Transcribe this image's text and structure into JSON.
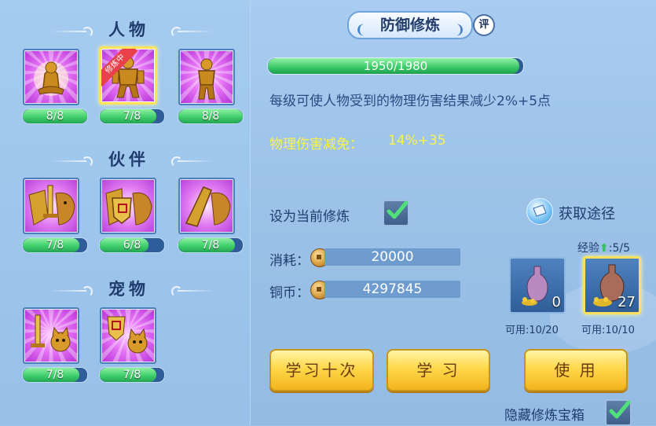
{
  "left_panel": {
    "sections": [
      {
        "title": "人物",
        "items": [
          {
            "icon": "character-seated-icon",
            "progress_text": "8/8",
            "progress": 1.0,
            "training": false
          },
          {
            "icon": "character-armor-icon",
            "progress_text": "7/8",
            "progress": 0.875,
            "training": true,
            "ribbon": "修炼中"
          },
          {
            "icon": "character-standing-icon",
            "progress_text": "8/8",
            "progress": 1.0,
            "training": false
          }
        ]
      },
      {
        "title": "伙伴",
        "items": [
          {
            "icon": "partner-sword-icon",
            "progress_text": "7/8",
            "progress": 0.875
          },
          {
            "icon": "partner-shield-icon",
            "progress_text": "6/8",
            "progress": 0.75
          },
          {
            "icon": "partner-gauntlet-icon",
            "progress_text": "7/8",
            "progress": 0.875
          }
        ]
      },
      {
        "title": "宠物",
        "items": [
          {
            "icon": "pet-sword-icon",
            "progress_text": "7/8",
            "progress": 0.875
          },
          {
            "icon": "pet-shield-icon",
            "progress_text": "7/8",
            "progress": 0.875
          }
        ]
      }
    ]
  },
  "detail": {
    "title": "防御修炼",
    "rate_badge": "评",
    "exp_text": "1950/1980",
    "exp_progress": 0.985,
    "description": "每级可使人物受到的物理伤害结果减少2%+5点",
    "effect_label": "物理伤害减免：",
    "effect_value": "14%+35",
    "set_current_label": "设为当前修炼",
    "set_current_checked": true,
    "get_way_label": "获取途径",
    "cost_label": "消耗：",
    "cost_value": "20000",
    "coin_label": "铜币：",
    "coin_value": "4297845",
    "learn_ten_label": "学习十次",
    "learn_label": "学 习",
    "use_label": "使 用",
    "exp_info_label": "经验",
    "exp_info_value": ":5/5",
    "items": [
      {
        "icon": "potion-vase-icon",
        "count": "0",
        "usable": "可用:10/20"
      },
      {
        "icon": "potion-vase-gold-icon",
        "count": "27",
        "usable": "可用:10/10",
        "selected": true
      }
    ],
    "hide_box_label": "隐藏修炼宝箱",
    "hide_box_checked": true
  },
  "colors": {
    "accent_gold": "#ffd84a",
    "progress_green": "#3fcf6b",
    "highlight_yellow": "#f8f44c",
    "text_dark_blue": "#203c6e"
  }
}
